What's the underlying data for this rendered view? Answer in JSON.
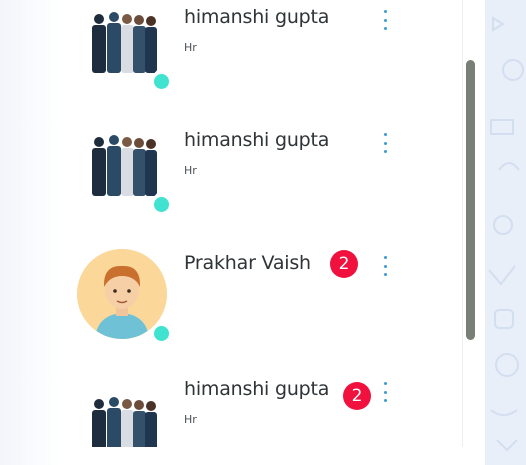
{
  "contacts": [
    {
      "name": "himanshi gupta",
      "role": "Hr",
      "avatar_icon": "group-photo-avatar",
      "online": true,
      "unread": ""
    },
    {
      "name": "himanshi gupta",
      "role": "Hr",
      "avatar_icon": "group-photo-avatar",
      "online": true,
      "unread": ""
    },
    {
      "name": "Prakhar Vaish",
      "role": "",
      "avatar_icon": "cartoon-man-avatar",
      "online": true,
      "unread": "2"
    },
    {
      "name": "himanshi gupta",
      "role": "Hr",
      "avatar_icon": "group-photo-avatar",
      "online": false,
      "unread": "2"
    }
  ],
  "menu_icon": "kebab-menu-icon",
  "colors": {
    "online": "#40e3cf",
    "badge": "#f0113f",
    "menu_dots": "#3d9bd4",
    "scrollbar_thumb": "#797f77",
    "side_panel": "#e8eff9"
  }
}
